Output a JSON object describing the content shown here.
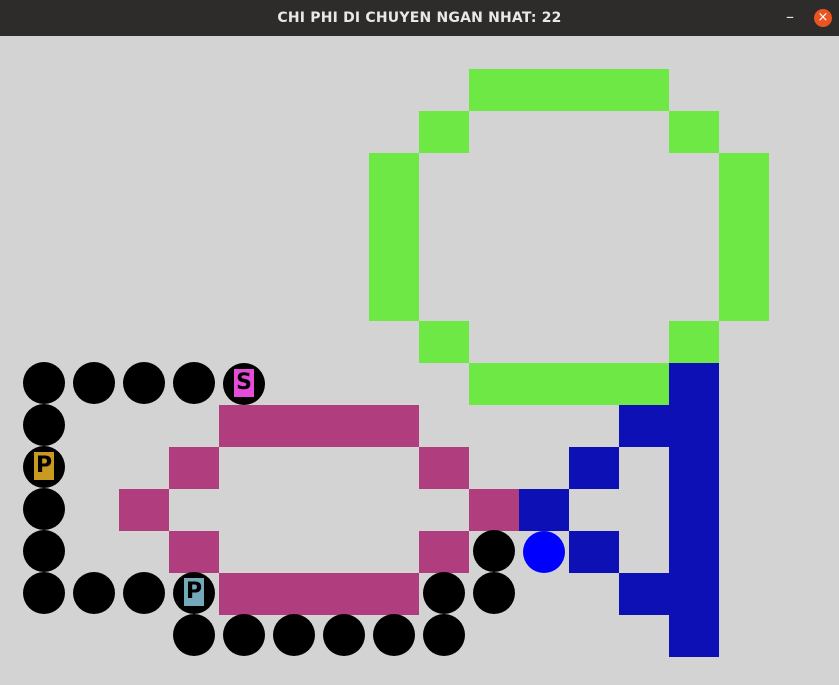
{
  "window": {
    "title": "CHI PHI DI CHUYEN NGAN NHAT: 22",
    "minimize_glyph": "–",
    "close_glyph": "×"
  },
  "colors": {
    "background": "#d3d3d3",
    "green": "#6ee845",
    "magenta": "#b03d7d",
    "navy": "#0d10b5",
    "ball": "#0000ff",
    "path_dot": "#000000",
    "start_label_bg": "#e64bd9",
    "parking_1_bg": "#c89a1f",
    "parking_2_bg": "#73a9b8"
  },
  "markers": {
    "start": {
      "letter": "S"
    },
    "parking_1": {
      "letter": "P"
    },
    "parking_2": {
      "letter": "P"
    }
  }
}
